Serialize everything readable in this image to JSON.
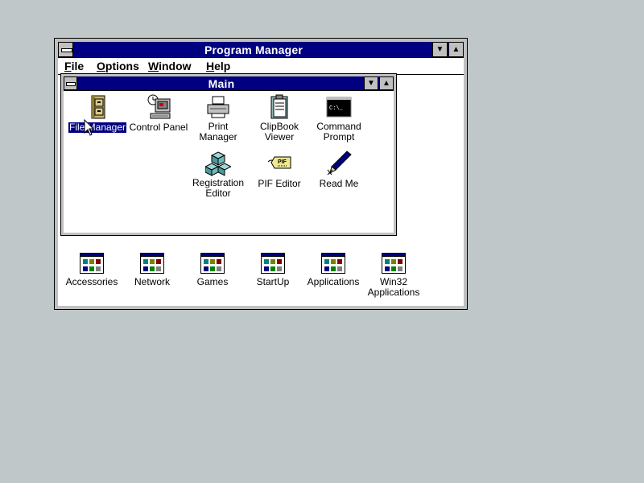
{
  "program_manager": {
    "title": "Program Manager",
    "menu": [
      {
        "label": "File",
        "mnemonic": "F"
      },
      {
        "label": "Options",
        "mnemonic": "O"
      },
      {
        "label": "Window",
        "mnemonic": "W"
      },
      {
        "label": "Help",
        "mnemonic": "H"
      }
    ]
  },
  "main_group": {
    "title": "Main",
    "items": [
      {
        "label": "File Manager",
        "icon": "file-cabinet-icon",
        "selected": true
      },
      {
        "label": "Control Panel",
        "icon": "control-panel-icon"
      },
      {
        "label": "Print Manager",
        "icon": "printer-icon"
      },
      {
        "label_lines": [
          "ClipBook",
          "Viewer"
        ],
        "icon": "clipbook-icon"
      },
      {
        "label_lines": [
          "Command",
          "Prompt"
        ],
        "icon": "command-prompt-icon"
      },
      {
        "label_lines": [
          "Registration",
          "Editor"
        ],
        "icon": "registry-cubes-icon"
      },
      {
        "label": "PIF Editor",
        "icon": "pif-tag-icon"
      },
      {
        "label": "Read Me",
        "icon": "pen-readme-icon"
      }
    ]
  },
  "groups": [
    {
      "label": "Accessories"
    },
    {
      "label": "Network"
    },
    {
      "label": "Games"
    },
    {
      "label": "StartUp"
    },
    {
      "label": "Applications"
    },
    {
      "label_lines": [
        "Win32",
        "Applications"
      ]
    }
  ],
  "colors": {
    "desktop": "#c0c7c8",
    "titlebar_active": "#000080",
    "selection": "#000080"
  }
}
